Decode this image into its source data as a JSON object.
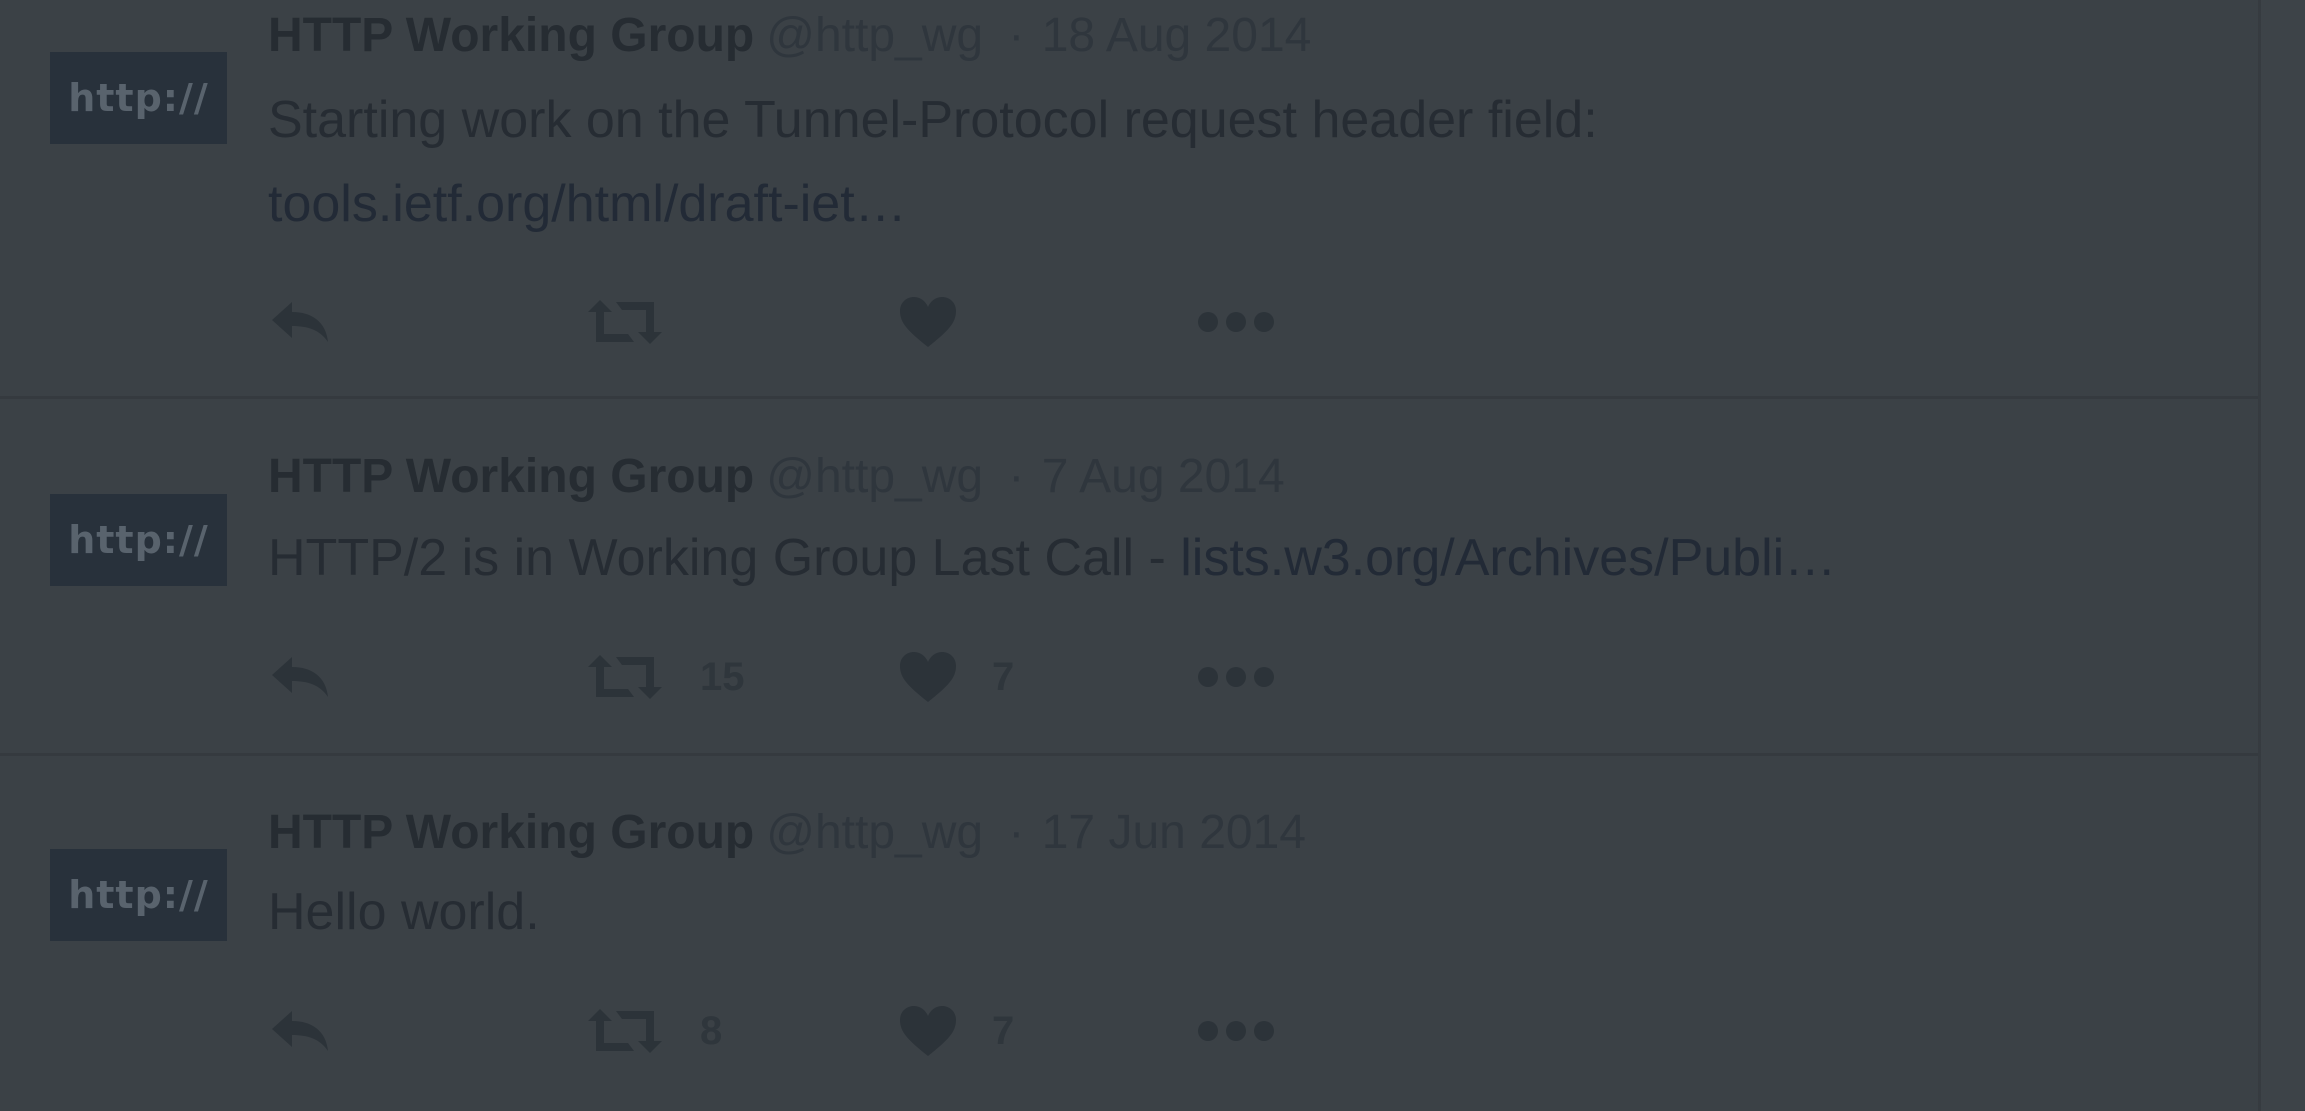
{
  "tweets": [
    {
      "avatar_text": "http://",
      "name": "HTTP Working Group",
      "handle": "@http_wg",
      "separator": "·",
      "date": "18 Aug 2014",
      "text_line1": "Starting work on the Tunnel-Protocol request header field:",
      "text_line2": "tools.ietf.org/html/draft-iet…",
      "retweets": "",
      "likes": ""
    },
    {
      "avatar_text": "http://",
      "name": "HTTP Working Group",
      "handle": "@http_wg",
      "separator": "·",
      "date": "7 Aug 2014",
      "text_prefix": "HTTP/2 is in Working Group Last Call - ",
      "text_link": "lists.w3.org/Archives/Publi…",
      "retweets": "15",
      "likes": "7"
    },
    {
      "avatar_text": "http://",
      "name": "HTTP Working Group",
      "handle": "@http_wg",
      "separator": "·",
      "date": "17 Jun 2014",
      "text_line1": "Hello world.",
      "retweets": "8",
      "likes": "7"
    }
  ],
  "icons": {
    "reply": "reply-icon",
    "retweet": "retweet-icon",
    "like": "heart-icon",
    "more": "more-icon"
  },
  "colors": {
    "overlay_background": "#3a4045",
    "avatar_background": "#28313b",
    "text": "#262c33",
    "muted": "#2f363d"
  }
}
